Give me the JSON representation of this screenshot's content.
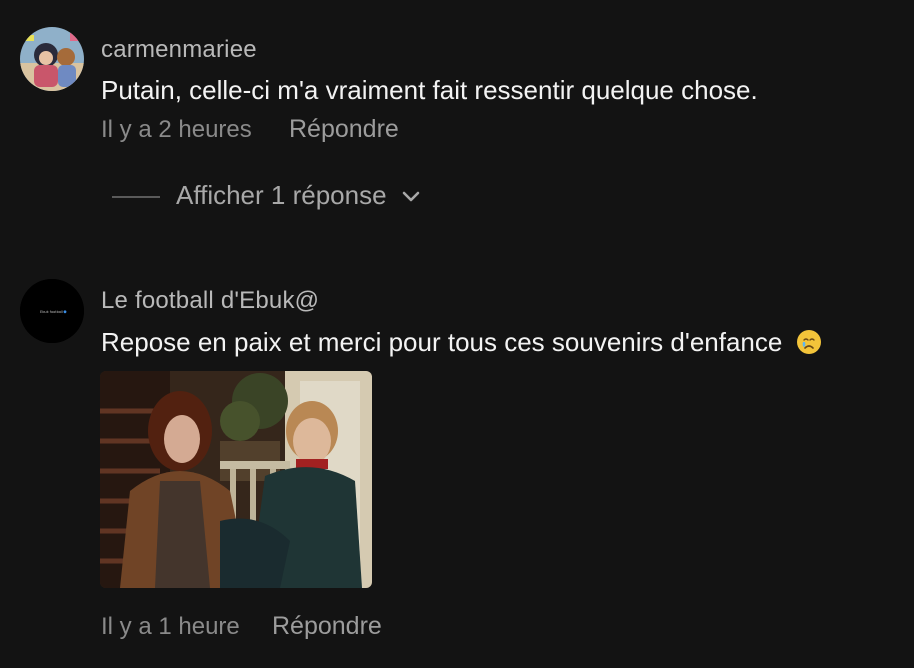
{
  "comments": [
    {
      "username": "carmenmariee",
      "text": "Putain, celle-ci m'a vraiment fait ressentir quelque chose.",
      "time": "Il y a 2 heures",
      "reply_label": "Répondre",
      "view_replies_label": "Afficher 1 réponse"
    },
    {
      "username": "Le football d'Ebuk@",
      "text": "Repose en paix et merci pour tous ces souvenirs d'enfance",
      "emoji": "crying-face-emoji",
      "avatar_text": "Ebuk football",
      "time": "Il y a 1 heure",
      "reply_label": "Répondre"
    }
  ],
  "colors": {
    "background": "#131313",
    "primary_text": "#f3f3f3",
    "secondary_text": "#8a8a8a"
  }
}
